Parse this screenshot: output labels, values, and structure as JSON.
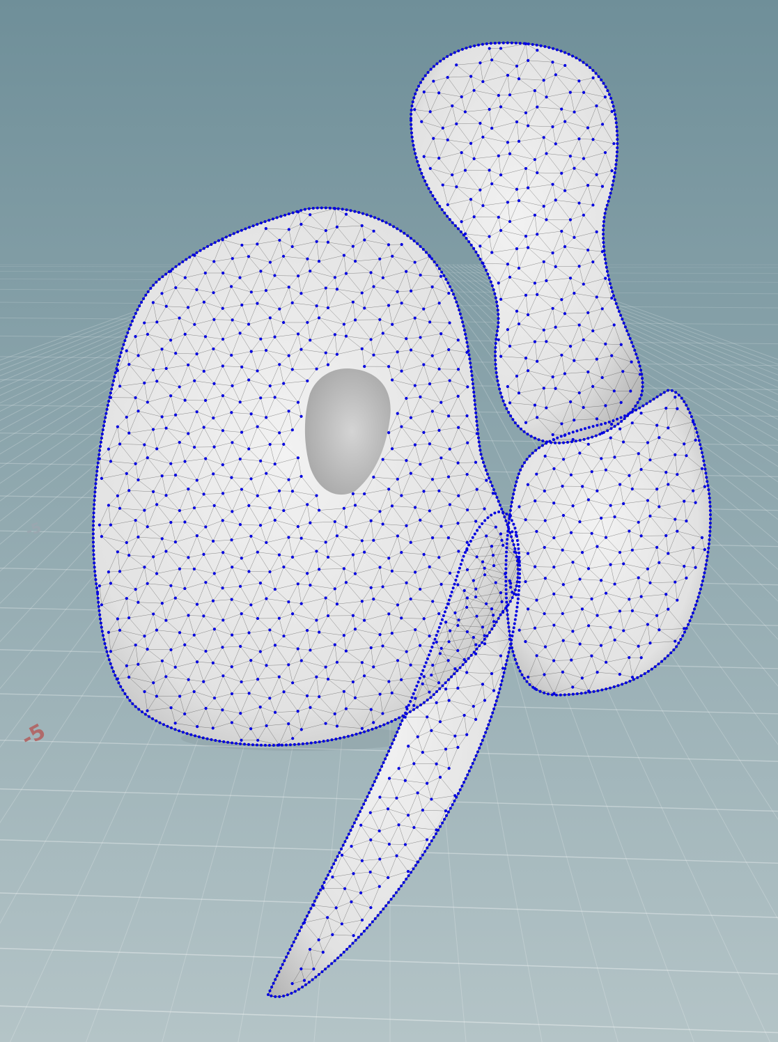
{
  "viewport": {
    "background_top": "#6f8f99",
    "background_bottom": "#b4c4c7",
    "grid_color": "#ffffff",
    "grid_opacity": 0.28,
    "mesh_fill": "#e7e7e7",
    "mesh_shadow": "#9a9a9a",
    "wire_color": "#222222",
    "point_color": "#0000e0"
  },
  "axis_labels": [
    {
      "text": "-5",
      "color": "#b06a6a"
    },
    {
      "text": "-5",
      "color": "#9aa7b0"
    }
  ],
  "geometry": {
    "display_mode": "shaded-wireframe",
    "show_points": true,
    "shape": "twisted-tube-mesh"
  }
}
